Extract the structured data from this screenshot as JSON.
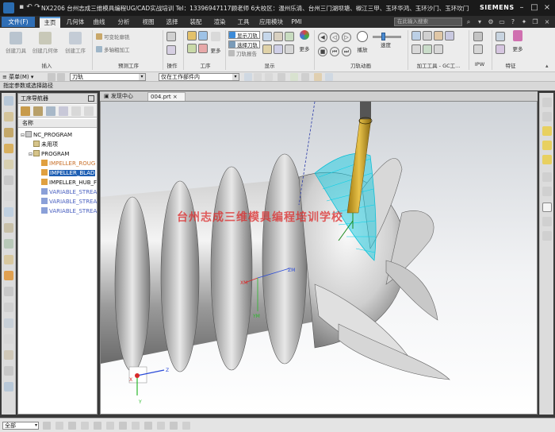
{
  "titlebar": {
    "title": "NX2206 台州志成三维模具编程UG/CAD实战培训  Tel：13396947117顾老师 6大校区：温州乐清、台州三门湖坝塘、椒江三甲、玉环华鸿、玉环沙门、玉环坎门 - 加工",
    "brand": "SIEMENS"
  },
  "menubar": {
    "file_label": "文件(F)",
    "tabs": [
      "主页",
      "几何体",
      "曲线",
      "分析",
      "视图",
      "选择",
      "装配",
      "渲染",
      "工具",
      "应用模块",
      "PMI"
    ],
    "active_tab": "主页",
    "search_placeholder": "在此输入搜索"
  },
  "ribbon": {
    "insert": {
      "buttons": [
        "创建刀具",
        "创建几何体",
        "创建工序"
      ],
      "label": "插入"
    },
    "preview": {
      "items": [
        "可变轮廓铣",
        "多轴粗加工"
      ],
      "label": "预测工序"
    },
    "operations": {
      "label": "操作"
    },
    "process": {
      "label": "工序"
    },
    "display": {
      "items": [
        "显示刀轨",
        "选择刀轨",
        "刀轨报告"
      ],
      "more": "更多",
      "label": "显示"
    },
    "animation": {
      "play": "播放",
      "speed": "速度",
      "label": "刀轨动画"
    },
    "machining_tools": {
      "label": "加工工具 - GC工..."
    },
    "ipw": {
      "label": "IPW"
    },
    "features": {
      "label": "特征"
    },
    "more": "更多"
  },
  "hintbar": {
    "menu_label": "菜单(M)",
    "filter_value": "刀轨",
    "scope_value": "仅在工作部件内"
  },
  "prompt": "指定参数或选择路径",
  "navigator": {
    "title": "工序导航器",
    "column": "名称",
    "rows": [
      {
        "label": "NC_PROGRAM",
        "indent": 0,
        "type": "root"
      },
      {
        "label": "未用项",
        "indent": 1,
        "type": "folder"
      },
      {
        "label": "PROGRAM",
        "indent": 1,
        "type": "folder"
      },
      {
        "label": "IMPELLER_ROUG",
        "indent": 2,
        "type": "op"
      },
      {
        "label": "IMPELLER_BLAD",
        "indent": 2,
        "type": "op-selected"
      },
      {
        "label": "IMPELLER_HUB_F",
        "indent": 2,
        "type": "op"
      },
      {
        "label": "VARIABLE_STREA",
        "indent": 2,
        "type": "op-var"
      },
      {
        "label": "VARIABLE_STREA",
        "indent": 2,
        "type": "op-var"
      },
      {
        "label": "VARIABLE_STREA",
        "indent": 2,
        "type": "op-var"
      }
    ]
  },
  "viewport": {
    "tabs": [
      "发现中心",
      "004.prt"
    ],
    "watermark": "台州志成三维模具编程培训学校",
    "axis_labels": {
      "x": "XM",
      "y": "YM",
      "z": "ZM"
    },
    "triad_labels": {
      "x": "X",
      "y": "Y",
      "z": "Z"
    }
  },
  "bottombar": {
    "filter_value": "全部"
  },
  "colors": {
    "accent": "#2f6eb5",
    "selection": "#1e5fb4",
    "toolpath": "#00c8e0",
    "tool": "#d9b02a",
    "watermark": "#dc2828"
  }
}
